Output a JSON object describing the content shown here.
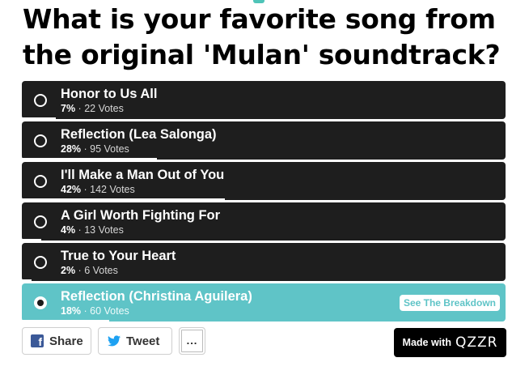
{
  "quiz": {
    "title": "What is your favorite song from the original 'Mulan' soundtrack?"
  },
  "options": [
    {
      "label": "Honor to Us All",
      "percent": "7%",
      "votes": "22 Votes",
      "fraction": 0.07
    },
    {
      "label": "Reflection (Lea Salonga)",
      "percent": "28%",
      "votes": "95 Votes",
      "fraction": 0.28
    },
    {
      "label": "I'll Make a Man Out of You",
      "percent": "42%",
      "votes": "142 Votes",
      "fraction": 0.42
    },
    {
      "label": "A Girl Worth Fighting For",
      "percent": "4%",
      "votes": "13 Votes",
      "fraction": 0.04
    },
    {
      "label": "True to Your Heart",
      "percent": "2%",
      "votes": "6 Votes",
      "fraction": 0.02
    },
    {
      "label": "Reflection (Christina Aguilera)",
      "percent": "18%",
      "votes": "60 Votes",
      "fraction": 0.18,
      "selected": true
    }
  ],
  "breakdown_label": "See The Breakdown",
  "share": {
    "facebook_label": "Share",
    "twitter_label": "Tweet",
    "more_label": "..."
  },
  "footer": {
    "made_with": "Made with",
    "brand": "QZZR"
  },
  "colors": {
    "option_bg": "#1e1e1e",
    "selected_bg": "#5fc4c7",
    "facebook": "#3b5998",
    "twitter": "#1da1f2"
  }
}
